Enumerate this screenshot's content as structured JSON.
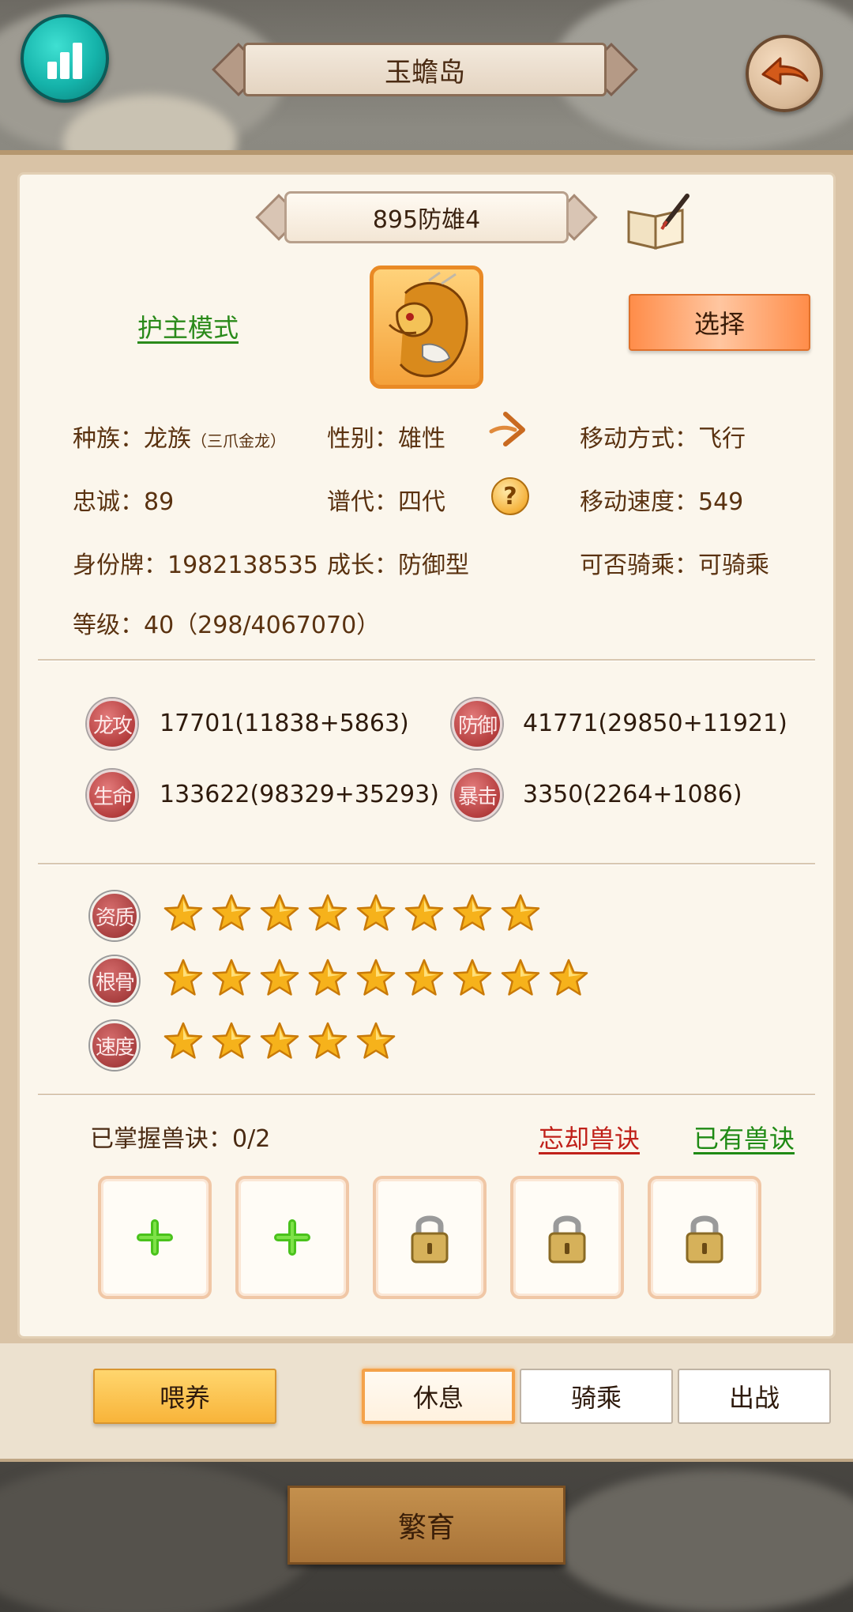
{
  "header": {
    "title": "玉蟾岛"
  },
  "pet": {
    "name": "895防雄4",
    "guard_mode_label": "护主模式",
    "select_label": "选择"
  },
  "info": {
    "race_label": "种族：",
    "race_value": "龙族",
    "race_sub": "（三爪金龙）",
    "gender_label": "性别：",
    "gender_value": "雄性",
    "move_mode_label": "移动方式：",
    "move_mode_value": "飞行",
    "loyalty_label": "忠诚：",
    "loyalty_value": "89",
    "generation_label": "谱代：",
    "generation_value": "四代",
    "move_speed_label": "移动速度：",
    "move_speed_value": "549",
    "id_label": "身份牌：",
    "id_value": "1982138535",
    "growth_label": "成长：",
    "growth_value": "防御型",
    "rideable_label": "可否骑乘：",
    "rideable_value": "可骑乘",
    "level_label": "等级：",
    "level_value": "40（298/4067070）"
  },
  "combat": {
    "attack_label": "龙攻",
    "attack_value": "17701(11838+5863)",
    "defense_label": "防御",
    "defense_value": "41771(29850+11921)",
    "hp_label": "生命",
    "hp_value": "133622(98329+35293)",
    "crit_label": "暴击",
    "crit_value": "3350(2264+1086)"
  },
  "aptitude": {
    "quality_label": "资质",
    "quality_stars": 8,
    "bone_label": "根骨",
    "bone_stars": 9,
    "speed_label": "速度",
    "speed_stars": 5
  },
  "skills": {
    "mastered_label": "已掌握兽诀：0/2",
    "forget_label": "忘却兽诀",
    "owned_label": "已有兽诀",
    "slots": [
      "add",
      "add",
      "locked",
      "locked",
      "locked"
    ]
  },
  "actions": {
    "feed": "喂养",
    "rest": "休息",
    "ride": "骑乘",
    "battle": "出战",
    "breed": "繁育"
  },
  "icons": {
    "stats": "bar-chart-icon",
    "back": "back-arrow-icon",
    "book": "book-quill-icon",
    "gender": "male-arrow-icon",
    "help": "question-icon",
    "add": "plus-icon",
    "lock": "padlock-icon"
  },
  "colors": {
    "guard_link": "#2a8a1a",
    "forget_link": "#c0211a",
    "owned_link": "#1f8a14",
    "star": "#f6b21b"
  }
}
